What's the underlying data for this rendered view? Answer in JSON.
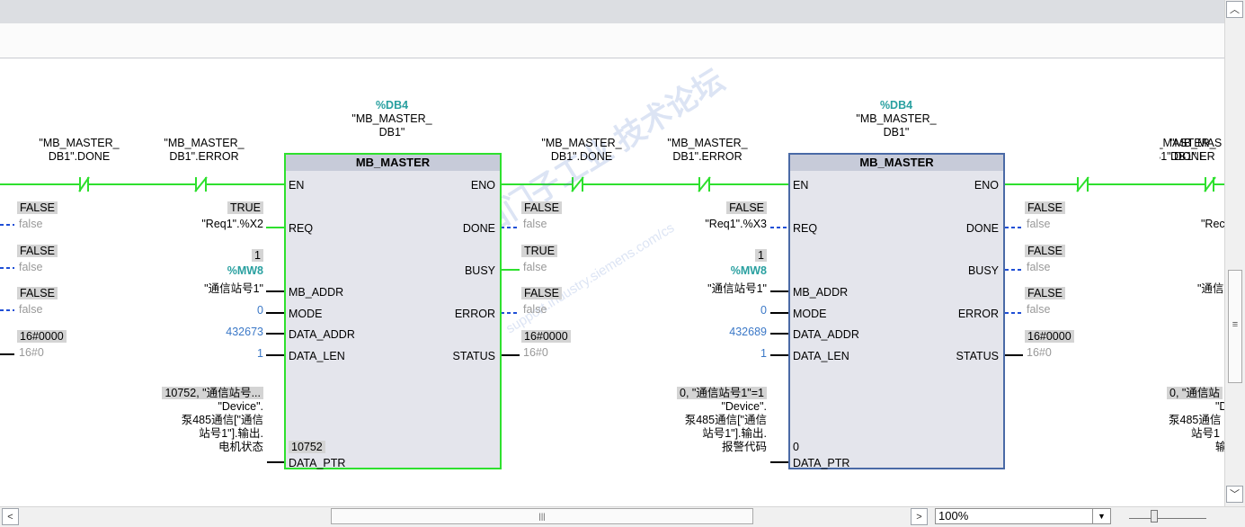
{
  "colors": {
    "rung_power": "#2ee02e",
    "selected_block_border": "#4a6aa6",
    "instance_tag": "#29a0a0",
    "constant": "#3b78c7",
    "monitor_gray": "#999999"
  },
  "instances": [
    {
      "db_name": "%DB4",
      "db_sym_line1": "\"MB_MASTER_",
      "db_sym_line2": "DB1\"",
      "type": "MB_MASTER",
      "contacts": [
        {
          "tag_line1": "\"MB_MASTER_",
          "tag_line2": "DB1\".DONE"
        },
        {
          "tag_line1": "\"MB_MASTER_",
          "tag_line2": "DB1\".ERROR"
        }
      ],
      "pins_in": {
        "en": "EN",
        "req": "REQ",
        "mb_addr": "MB_ADDR",
        "mode": "MODE",
        "data_addr": "DATA_ADDR",
        "data_len": "DATA_LEN",
        "data_ptr": "DATA_PTR"
      },
      "pins_out": {
        "eno": "ENO",
        "done": "DONE",
        "busy": "BUSY",
        "error": "ERROR",
        "status": "STATUS"
      },
      "req": {
        "monitor": "TRUE",
        "operand": "\"Req1\".%X2"
      },
      "mb_addr": {
        "monitor": "1",
        "address": "%MW8",
        "operand": "\"通信站号1\""
      },
      "mode": "0",
      "data_addr": "432673",
      "data_len": "1",
      "data_ptr": {
        "monitor": "10752, \"通信站号...",
        "line1": "\"Device\".",
        "line2": "泵485通信[\"通信",
        "line3": "站号1\"].输出.",
        "line4": "电机状态",
        "inner": "10752"
      },
      "out_done": {
        "monitor": "FALSE",
        "operand": "false"
      },
      "out_busy": {
        "monitor": "TRUE",
        "operand": "false"
      },
      "out_error": {
        "monitor": "FALSE",
        "operand": "false"
      },
      "out_status": {
        "monitor": "16#0000",
        "operand": "16#0"
      }
    },
    {
      "db_name": "%DB4",
      "db_sym_line1": "\"MB_MASTER_",
      "db_sym_line2": "DB1\"",
      "type": "MB_MASTER",
      "contacts": [
        {
          "tag_line1": "\"MB_MASTER_",
          "tag_line2": "DB1\".DONE"
        },
        {
          "tag_line1": "\"MB_MASTER_",
          "tag_line2": "DB1\".ERROR"
        }
      ],
      "pins_in": {
        "en": "EN",
        "req": "REQ",
        "mb_addr": "MB_ADDR",
        "mode": "MODE",
        "data_addr": "DATA_ADDR",
        "data_len": "DATA_LEN",
        "data_ptr": "DATA_PTR"
      },
      "pins_out": {
        "eno": "ENO",
        "done": "DONE",
        "busy": "BUSY",
        "error": "ERROR",
        "status": "STATUS"
      },
      "req": {
        "monitor": "FALSE",
        "operand": "\"Req1\".%X3"
      },
      "mb_addr": {
        "monitor": "1",
        "address": "%MW8",
        "operand": "\"通信站号1\""
      },
      "mode": "0",
      "data_addr": "432689",
      "data_len": "1",
      "data_ptr": {
        "monitor": "0, \"通信站号1\"=1",
        "line1": "\"Device\".",
        "line2": "泵485通信[\"通信",
        "line3": "站号1\"].输出.",
        "line4": "报警代码",
        "inner": "0"
      },
      "out_done": {
        "monitor": "FALSE",
        "operand": "false"
      },
      "out_busy": {
        "monitor": "FALSE",
        "operand": "false"
      },
      "out_error": {
        "monitor": "FALSE",
        "operand": "false"
      },
      "out_status": {
        "monitor": "16#0000",
        "operand": "16#0"
      }
    }
  ],
  "left_partial": {
    "done": {
      "monitor": "FALSE",
      "operand": "false"
    },
    "busy": {
      "monitor": "FALSE",
      "operand": "false"
    },
    "error": {
      "monitor": "FALSE",
      "operand": "false"
    },
    "status": {
      "monitor": "16#0000",
      "operand": "16#0"
    }
  },
  "right_partial": {
    "c1_line1": "\"MB_MASTER_",
    "c1_line2": "DB1\".DONE",
    "c2_line1": "\"MB_MAS",
    "c2_line2": "DB1\".ER",
    "req": "\"Rec",
    "addr": "\"通信",
    "ptr_monitor": "0, \"通信站",
    "ptr1": "\"D",
    "ptr2": "泵485通信",
    "ptr3": "站号1",
    "ptr4": "输"
  },
  "watermark": {
    "text1": "西门子工业 技术论坛",
    "text2": "support.industry.siemens.com/cs"
  },
  "statusbar": {
    "zoom": "100%",
    "scroll_mid": "|||",
    "left_arrow": "<",
    "right_arrow": ">",
    "dropdown": "▼"
  },
  "vscroll": {
    "up": "︿",
    "down": "﹀",
    "grip": "≡"
  }
}
